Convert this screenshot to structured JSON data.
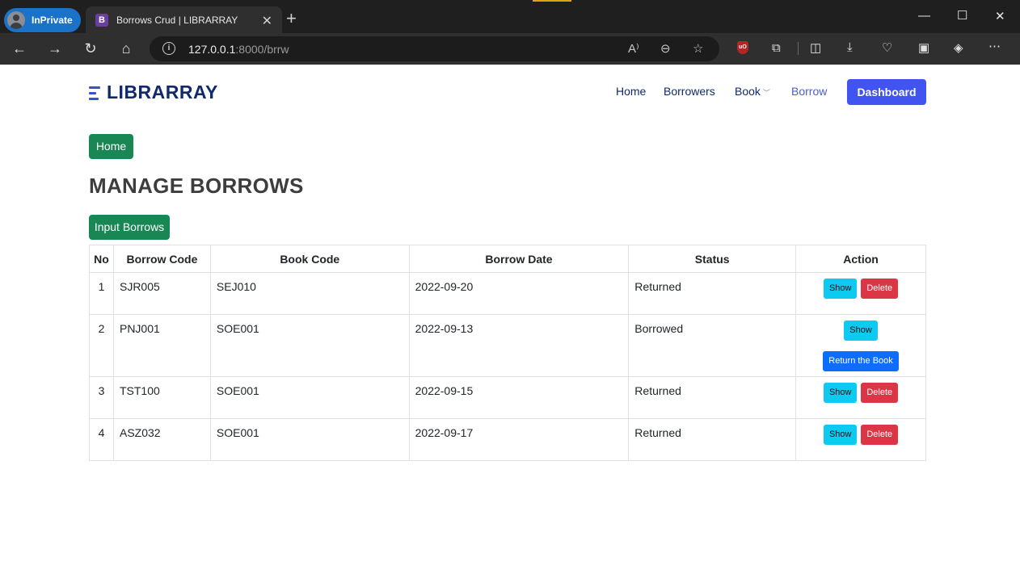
{
  "browser": {
    "inprivate_label": "InPrivate",
    "tab_favicon_letter": "B",
    "tab_title": "Borrows Crud | LIBRARRAY",
    "url_host": "127.0.0.1",
    "url_rest": ":8000/brrw"
  },
  "site": {
    "brand": "LIBRARRAY",
    "nav": {
      "home": "Home",
      "borrowers": "Borrowers",
      "book": "Book",
      "borrow": "Borrow",
      "dashboard": "Dashboard"
    }
  },
  "main": {
    "home_button": "Home",
    "title": "MANAGE BORROWS",
    "input_button": "Input Borrows",
    "table": {
      "headers": [
        "No",
        "Borrow Code",
        "Book Code",
        "Borrow Date",
        "Status",
        "Action"
      ],
      "rows": [
        {
          "no": "1",
          "borrow_code": "SJR005",
          "book_code": "SEJ010",
          "borrow_date": "2022-09-20",
          "status": "Returned",
          "show": "Show",
          "delete": "Delete"
        },
        {
          "no": "2",
          "borrow_code": "PNJ001",
          "book_code": "SOE001",
          "borrow_date": "2022-09-13",
          "status": "Borrowed",
          "show": "Show",
          "return": "Return the Book"
        },
        {
          "no": "3",
          "borrow_code": "TST100",
          "book_code": "SOE001",
          "borrow_date": "2022-09-15",
          "status": "Returned",
          "show": "Show",
          "delete": "Delete"
        },
        {
          "no": "4",
          "borrow_code": "ASZ032",
          "book_code": "SOE001",
          "borrow_date": "2022-09-17",
          "status": "Returned",
          "show": "Show",
          "delete": "Delete"
        }
      ]
    }
  },
  "colors": {
    "primary": "#4154f1",
    "success": "#198754",
    "info": "#0dcaf0",
    "danger": "#dc3545",
    "blue": "#0d6efd",
    "brand_text": "#112a6b"
  }
}
